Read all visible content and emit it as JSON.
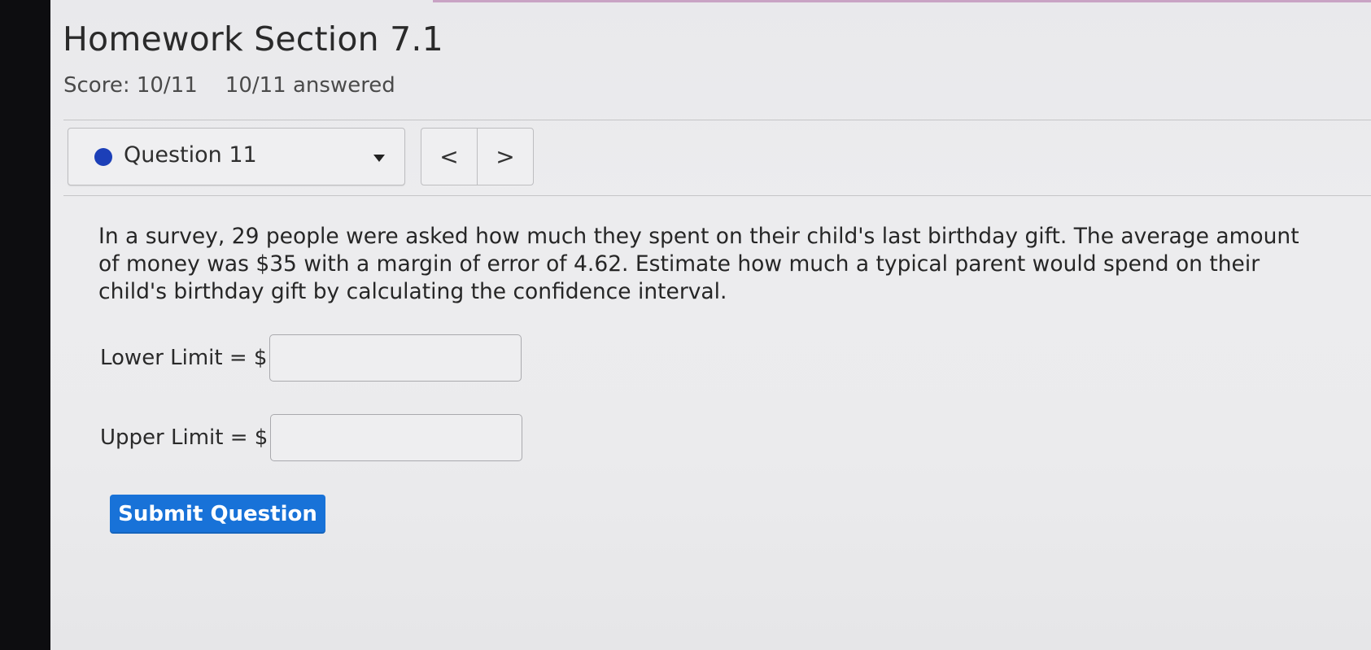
{
  "page": {
    "title": "Homework Section 7.1",
    "score": "Score: 10/11",
    "answered": "10/11 answered"
  },
  "question_nav": {
    "selector_label": "Question 11",
    "prev_label": "<",
    "next_label": ">",
    "status_color": "#1c3fb8"
  },
  "question": {
    "text": "In a survey, 29 people were asked how much they spent on their child's last birthday gift. The average amount of money was $35 with a margin of error of 4.62. Estimate how much a typical parent would spend on their child's birthday gift by calculating the confidence interval."
  },
  "answers": {
    "lower_label": "Lower Limit = $",
    "lower_value": "",
    "upper_label": "Upper Limit = $",
    "upper_value": ""
  },
  "actions": {
    "submit_label": "Submit Question",
    "submit_color": "#1872d8"
  }
}
